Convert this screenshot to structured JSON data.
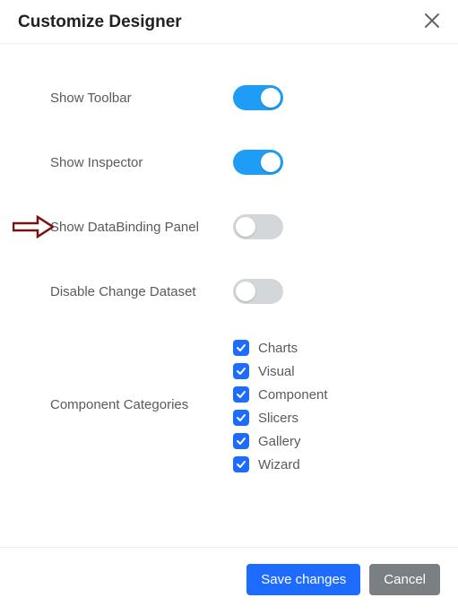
{
  "header": {
    "title": "Customize Designer"
  },
  "options": {
    "show_toolbar": {
      "label": "Show Toolbar",
      "on": true
    },
    "show_inspector": {
      "label": "Show Inspector",
      "on": true
    },
    "show_databinding": {
      "label": "Show DataBinding Panel",
      "on": false
    },
    "disable_change_dataset": {
      "label": "Disable Change Dataset",
      "on": false
    }
  },
  "categories": {
    "label": "Component Categories",
    "items": [
      {
        "label": "Charts",
        "checked": true
      },
      {
        "label": "Visual",
        "checked": true
      },
      {
        "label": "Component",
        "checked": true
      },
      {
        "label": "Slicers",
        "checked": true
      },
      {
        "label": "Gallery",
        "checked": true
      },
      {
        "label": "Wizard",
        "checked": true
      }
    ]
  },
  "footer": {
    "save": "Save changes",
    "cancel": "Cancel"
  },
  "colors": {
    "toggle_on": "#1e9df7",
    "toggle_off": "#d4d7d9",
    "checkbox": "#1e6cff",
    "primary_btn": "#1e6cff",
    "secondary_btn": "#7a7f83",
    "arrow": "#7a1010"
  }
}
